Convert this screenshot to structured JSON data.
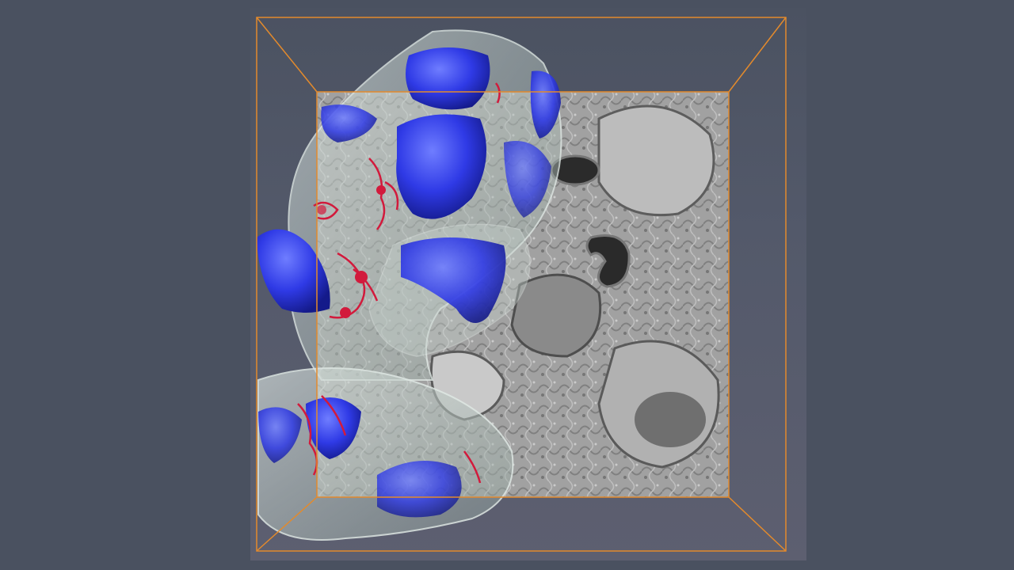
{
  "viewer": {
    "label": "",
    "colors": {
      "background": "#4a5160",
      "bounding_box": "#e38a2c",
      "nucleus_surface": "#2a35e0",
      "mitochondria_surface": "#d21a3c",
      "cell_membrane_surface": "#b8c4bf",
      "em_slice": "#9a9a9a"
    },
    "objects": [
      {
        "name": "em-slice",
        "icon": "grayscale-image"
      },
      {
        "name": "cell-membrane-meshes",
        "icon": "translucent-mesh"
      },
      {
        "name": "nucleus-meshes",
        "icon": "blue-mesh"
      },
      {
        "name": "mitochondria-meshes",
        "icon": "red-mesh"
      },
      {
        "name": "bounding-box",
        "icon": "wireframe-box"
      }
    ]
  }
}
